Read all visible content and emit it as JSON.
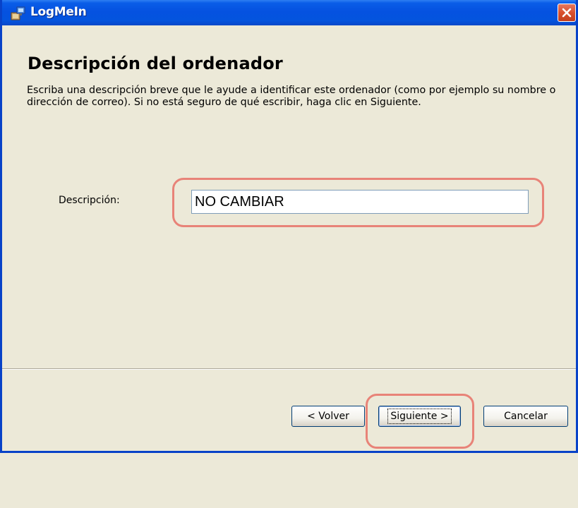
{
  "window": {
    "title": "LogMeIn"
  },
  "page": {
    "heading": "Descripción del ordenador",
    "description": "Escriba una descripción breve que le ayude a identificar este ordenador (como por ejemplo su nombre o dirección de correo). Si no está seguro de qué escribir, haga clic en Siguiente."
  },
  "form": {
    "description_label": "Descripción:",
    "description_value": "NO CAMBIAR"
  },
  "buttons": {
    "back": "< Volver",
    "next": "Siguiente >",
    "cancel": "Cancelar"
  },
  "colors": {
    "titlebar": "#0552E0",
    "window_bg": "#ECE9D8",
    "highlight": "#E88378",
    "close_button": "#D9502E"
  },
  "icons": {
    "app": "logmein-installer-icon",
    "close": "close-icon"
  }
}
